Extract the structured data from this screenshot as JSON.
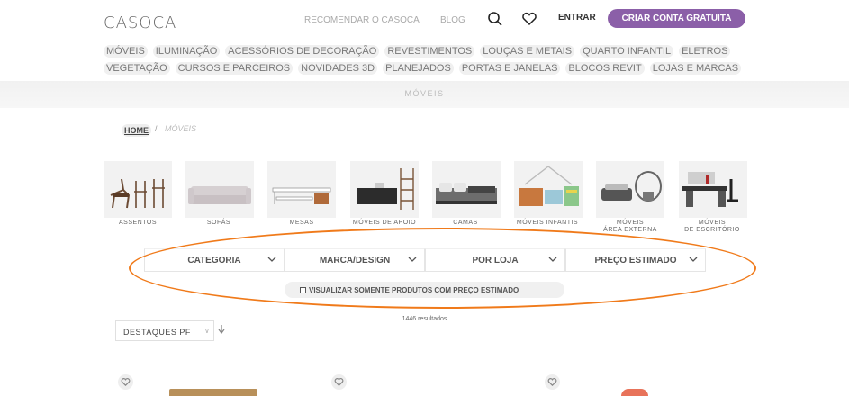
{
  "header": {
    "logo": "CASOCA",
    "recommend_label": "RECOMENDAR O CASOCA",
    "blog_label": "BLOG",
    "login_label": "ENTRAR",
    "signup_label": "CRIAR CONTA GRATUITA",
    "accent_color": "#8b5fa8"
  },
  "categories_row1": [
    "MÓVEIS",
    "ILUMINAÇÃO",
    "ACESSÓRIOS DE DECORAÇÃO",
    "REVESTIMENTOS",
    "LOUÇAS E METAIS",
    "QUARTO INFANTIL",
    "ELETROS"
  ],
  "categories_row2": [
    "VEGETAÇÃO",
    "CURSOS E PARCEIROS",
    "NOVIDADES 3D",
    "PLANEJADOS",
    "PORTAS E JANELAS",
    "BLOCOS REVIT",
    "LOJAS E MARCAS"
  ],
  "section_title": "MÓVEIS",
  "breadcrumb": {
    "home": "HOME",
    "separator": "/",
    "current": "MÓVEIS"
  },
  "subcategories": [
    {
      "label": "ASSENTOS",
      "icon": "chairs-image"
    },
    {
      "label": "SOFÁS",
      "icon": "sofa-image"
    },
    {
      "label": "MESAS",
      "icon": "table-image"
    },
    {
      "label": "MÓVEIS DE APOIO",
      "icon": "sideboard-image"
    },
    {
      "label": "CAMAS",
      "icon": "bed-image"
    },
    {
      "label": "MÓVEIS INFANTIS",
      "icon": "crib-image"
    },
    {
      "label": "MÓVEIS\nÁREA EXTERNA",
      "icon": "outdoor-furniture-image"
    },
    {
      "label": "MÓVEIS\nDE ESCRITÓRIO",
      "icon": "office-desk-image"
    }
  ],
  "filters": [
    "CATEGORIA",
    "MARCA/DESIGN",
    "POR LOJA",
    "PREÇO ESTIMADO"
  ],
  "estimated_price_only": "VISUALIZAR SOMENTE PRODUTOS COM PREÇO ESTIMADO",
  "results_count": "1446 resultados",
  "sort": {
    "value": "DESTAQUES PF"
  }
}
